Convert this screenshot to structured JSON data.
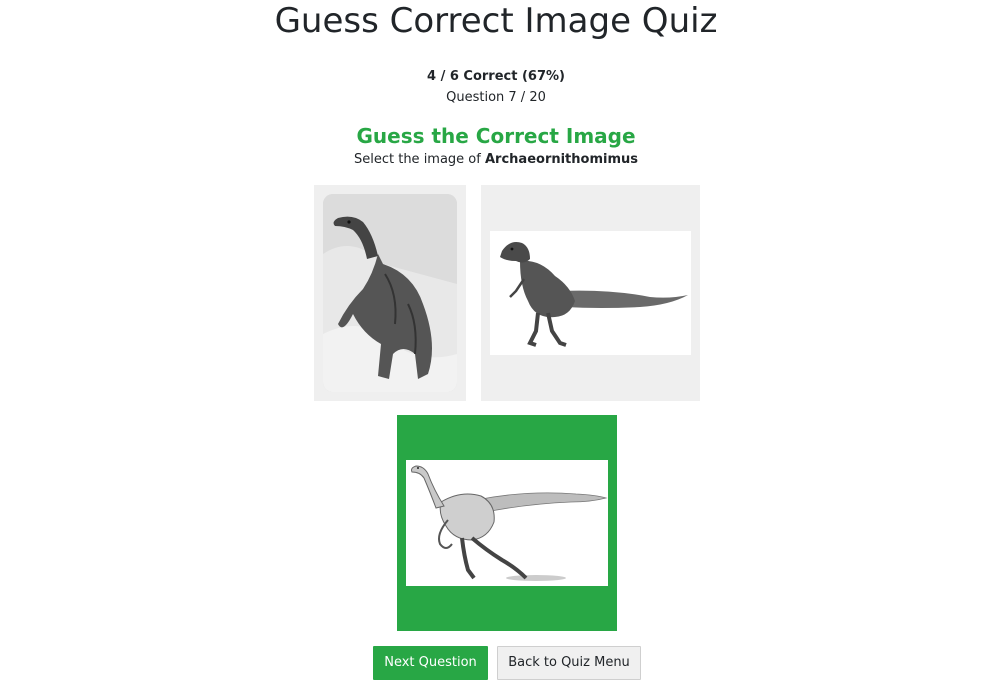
{
  "page": {
    "title": "Guess Correct Image Quiz",
    "score": "4 / 6 Correct (67%)",
    "question_counter": "Question 7 / 20"
  },
  "quiz": {
    "heading": "Guess the Correct Image",
    "prompt_prefix": "Select the image of ",
    "target_name": "Archaeornithomimus",
    "options": [
      {
        "subject": "sauropod-like dinosaur illustration (black and white)",
        "state": "default"
      },
      {
        "subject": "small theropod dinosaur illustration",
        "state": "default"
      },
      {
        "subject": "ornithomimid dinosaur sketch",
        "state": "correct"
      }
    ]
  },
  "buttons": {
    "next": "Next Question",
    "back": "Back to Quiz Menu"
  },
  "colors": {
    "correct": "#28a745",
    "option_bg": "#efefef"
  }
}
